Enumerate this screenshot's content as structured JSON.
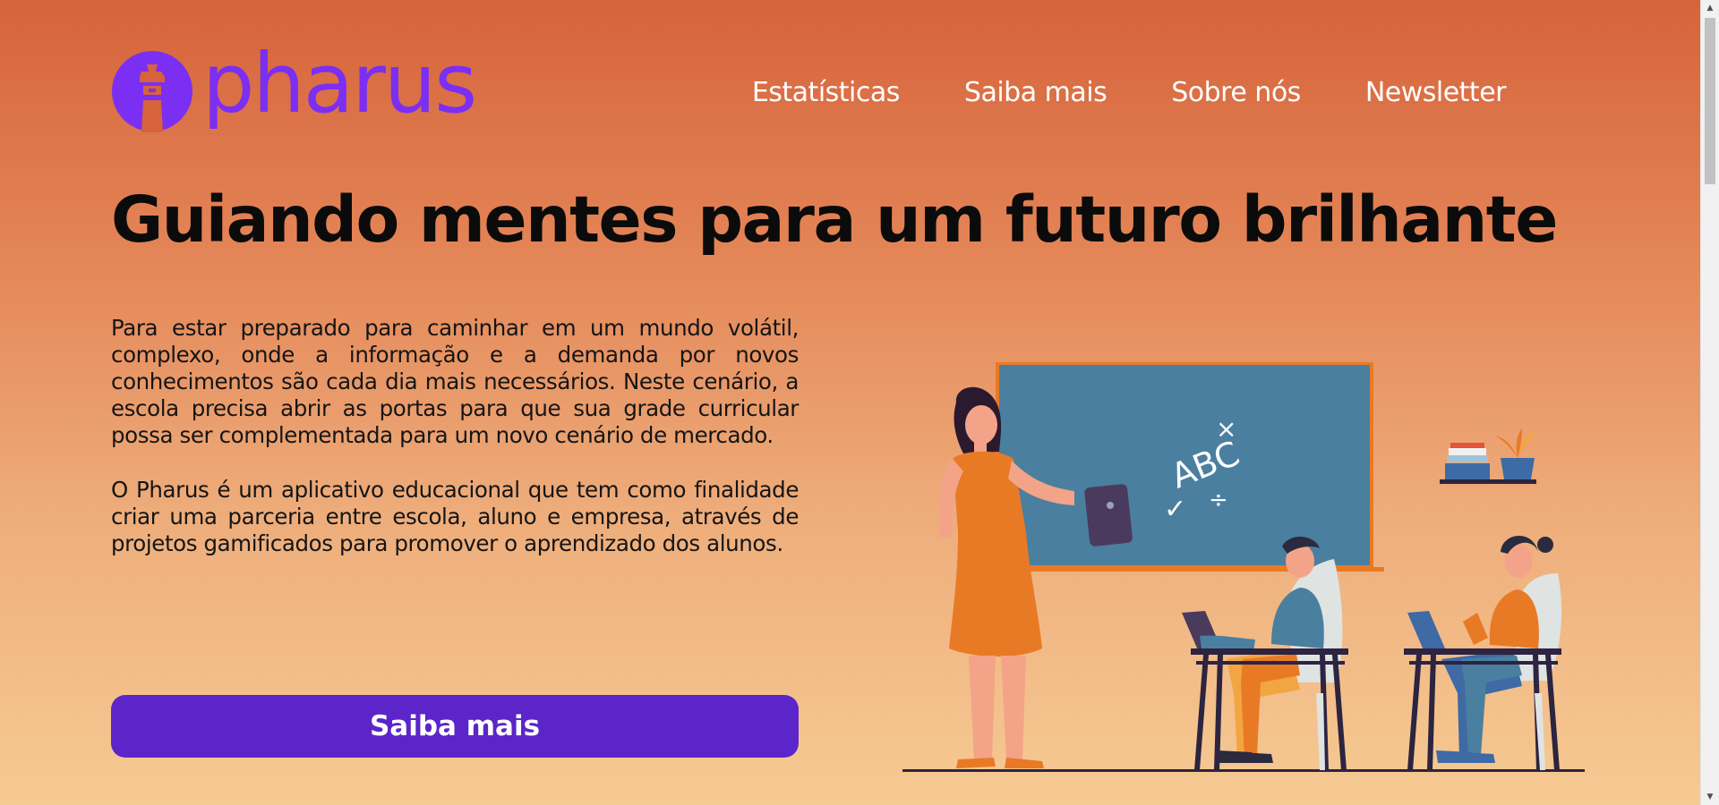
{
  "brand": {
    "name": "pharus",
    "color": "#7b2ff2",
    "logo_icon": "lighthouse-icon"
  },
  "nav": {
    "items": [
      {
        "label": "Estatísticas"
      },
      {
        "label": "Saiba mais"
      },
      {
        "label": "Sobre nós"
      },
      {
        "label": "Newsletter"
      }
    ]
  },
  "hero": {
    "title": "Guiando mentes para um futuro brilhante",
    "paragraphs": [
      "Para estar preparado para caminhar em um mundo volátil, complexo, onde a informação e a demanda por novos conhecimentos são cada dia mais necessários. Neste cenário, a escola precisa abrir as portas para que sua grade curricular possa ser complementada para um novo cenário de mercado.",
      "O Pharus é um aplicativo educacional que tem como finalidade criar uma parceria entre escola, aluno e empresa, através de projetos gamificados para promover o aprendizado dos alunos."
    ],
    "cta_label": "Saiba mais",
    "cta_color": "#5b25c9"
  },
  "illustration": {
    "chalkboard": {
      "letters": "ABC",
      "symbols": [
        "×",
        "÷",
        "✓"
      ]
    }
  },
  "colors": {
    "gradient_top": "#d6633b",
    "gradient_bottom": "#f6ca93",
    "nav_text": "#ffffff",
    "title_text": "#0b0b0b"
  }
}
